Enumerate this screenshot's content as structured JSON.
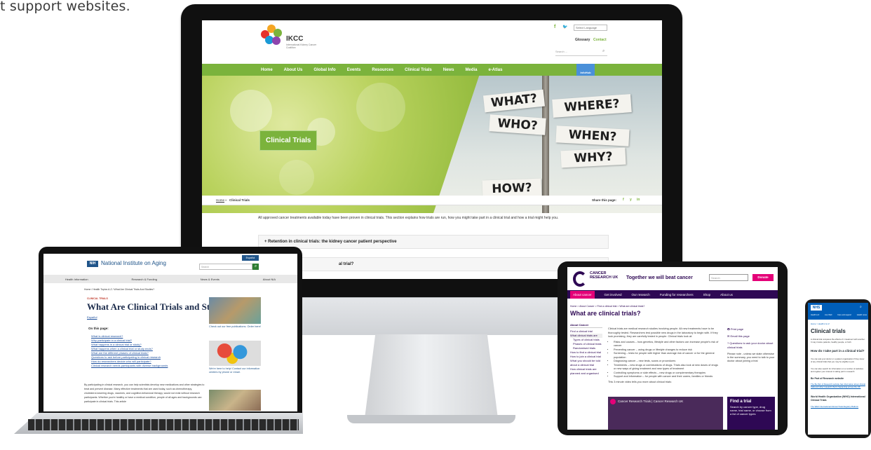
{
  "caption": "t support websites.",
  "ikcc": {
    "logo_text": "IKCC",
    "logo_sub": "International Kidney Cancer Coalition",
    "select_language": "Select Language",
    "glossary": "Glossary",
    "contact": "Contact",
    "search_placeholder": "Search ...",
    "nav": [
      "Home",
      "About Us",
      "Global Info",
      "Events",
      "Resources",
      "Clinical Trials",
      "News",
      "Media",
      "e-Atlas"
    ],
    "infohub": "InfoHub",
    "signs": [
      "WHAT?",
      "WHERE?",
      "WHO?",
      "WHEN?",
      "WHY?",
      "HOW?"
    ],
    "hero_title": "Clinical Trials",
    "breadcrumb_home": "Home",
    "breadcrumb_current": "Clinical Trials",
    "share": "Share this page:",
    "intro": "All approved cancer treatments available today have been proven in clinical trials. This section explains how trials are run, how you might take part in a clinical trial and how a trial might help you.",
    "accordion_1": "+  Retention in clinical trials: the kidney cancer patient perspective",
    "accordion_2_tail": "al trial?"
  },
  "nia": {
    "badge": "NIH",
    "org": "National Institute on Aging",
    "espanol": "Español",
    "search_placeholder": "Search",
    "nav": [
      "Health Information",
      "Research & Funding",
      "News & Events",
      "About NIA"
    ],
    "breadcrumb": "Home  /  Health Topics A-Z  /  What Are Clinical Trials And Studies?",
    "kicker": "CLINICAL TRIALS",
    "title": "What Are Clinical Trials and Studies?",
    "espanol_link": "Español",
    "on_page": "On this page:",
    "links": [
      "What is clinical research?",
      "Why participate in a clinical trial?",
      "What happens in a clinical trial or study?",
      "What happens when a clinical trial or study ends?",
      "What are the different phases of clinical trials?",
      "Questions to ask before participating in clinical research",
      "How do researchers decide who will participate?",
      "Clinical research needs participants with diverse backgrounds"
    ],
    "side_1": "Check out our free publications. Order here!",
    "side_2": "We're here to help! Contact our information centers by phone or email.",
    "body": "By participating in clinical research, you can help scientists develop new medications and other strategies to treat and prevent disease. Many effective treatments that are used today, such as chemotherapy, cholesterol-lowering drugs, vaccines, and cognitive-behavioral therapy, would not exist without research participants. Whether you're healthy or have a medical condition, people of all ages and backgrounds can participate in clinical trials. This article"
  },
  "cruk": {
    "logo": "CANCER RESEARCH UK",
    "tagline": "Together we will beat cancer",
    "search_placeholder": "Search",
    "donate": "Donate",
    "nav": [
      "About cancer",
      "Get involved",
      "Our research",
      "Funding for researchers",
      "Shop",
      "About us"
    ],
    "breadcrumb": "Home  >  About Cancer  >  Find a clinical trial  >  What are clinical trials?",
    "title": "What are clinical trials?",
    "side_head": "About Cancer",
    "side_items": [
      "Find a clinical trial",
      "What clinical trials are",
      "Types of clinical trials",
      "Phases of clinical trials",
      "Randomised trials",
      "How to find a clinical trial",
      "How to join a clinical trial",
      "What you should be told about a clinical trial",
      "How clinical trials are planned and organised"
    ],
    "main_intro": "Clinical trials are medical research studies involving people. All new treatments have to be thoroughly tested. Researchers test possible new drugs in the laboratory to begin with. If they look promising, they are carefully tested in people. Clinical trials look at:",
    "bullets": [
      "Risks and causes – how genetics, lifestyle and other factors can increase people's risk of cancer",
      "Preventing cancer – using drugs or lifestyle changes to reduce risk",
      "Screening – tests for people with higher than average risk of cancer or for the general population",
      "Diagnosing cancer – new tests, scans or procedures",
      "Treatments – new drugs or combinations of drugs. Trials also look at new doses of drugs or new ways of giving treatment and new types of treatment",
      "Controlling symptoms or side effects – new drugs or complementary therapies",
      "Support and information – for people with cancer and their carers, families or friends"
    ],
    "video_intro": "This 3 minute video tells you more about clinical trials:",
    "video_title": "Cancer Research Trials | Cancer Research UK",
    "print": "Print page",
    "email": "Email this page",
    "questions": "Questions to ask your doctor about clinical trials",
    "note": "Please note - unless we state otherwise in the summary, you need to talk to your doctor about joining a trial",
    "find_title": "Find a trial",
    "find_text": "Search by cancer type, drug name, trial name, or choose from a list of cancer types"
  },
  "nhs": {
    "badge": "NHS",
    "nav": [
      "Health A-Z",
      "Live Well",
      "Care and support",
      "Health news"
    ],
    "breadcrumb": "Home  >  Health A to Z",
    "title": "Clinical trials",
    "lead": "A clinical trial compares the effects of 1 treatment with another. It may involve patients, healthy people, or both.",
    "h2": "How do I take part in a clinical trial?",
    "p1": "You can ask your doctor or a patient organisation if they know of any clinical trials that you may be eligible to join.",
    "p2": "You can also search for information on a number of websites and register your interest in taking part in research.",
    "h3": "Be Part of Research website",
    "p3": "The Be Part of Research website has information about clinical trials and other research that is happening across the UK.",
    "h4": "World Health Organization (WHO) International Clinical Trials",
    "p4": "The WHO International Clinical Trials Registry Platform"
  }
}
